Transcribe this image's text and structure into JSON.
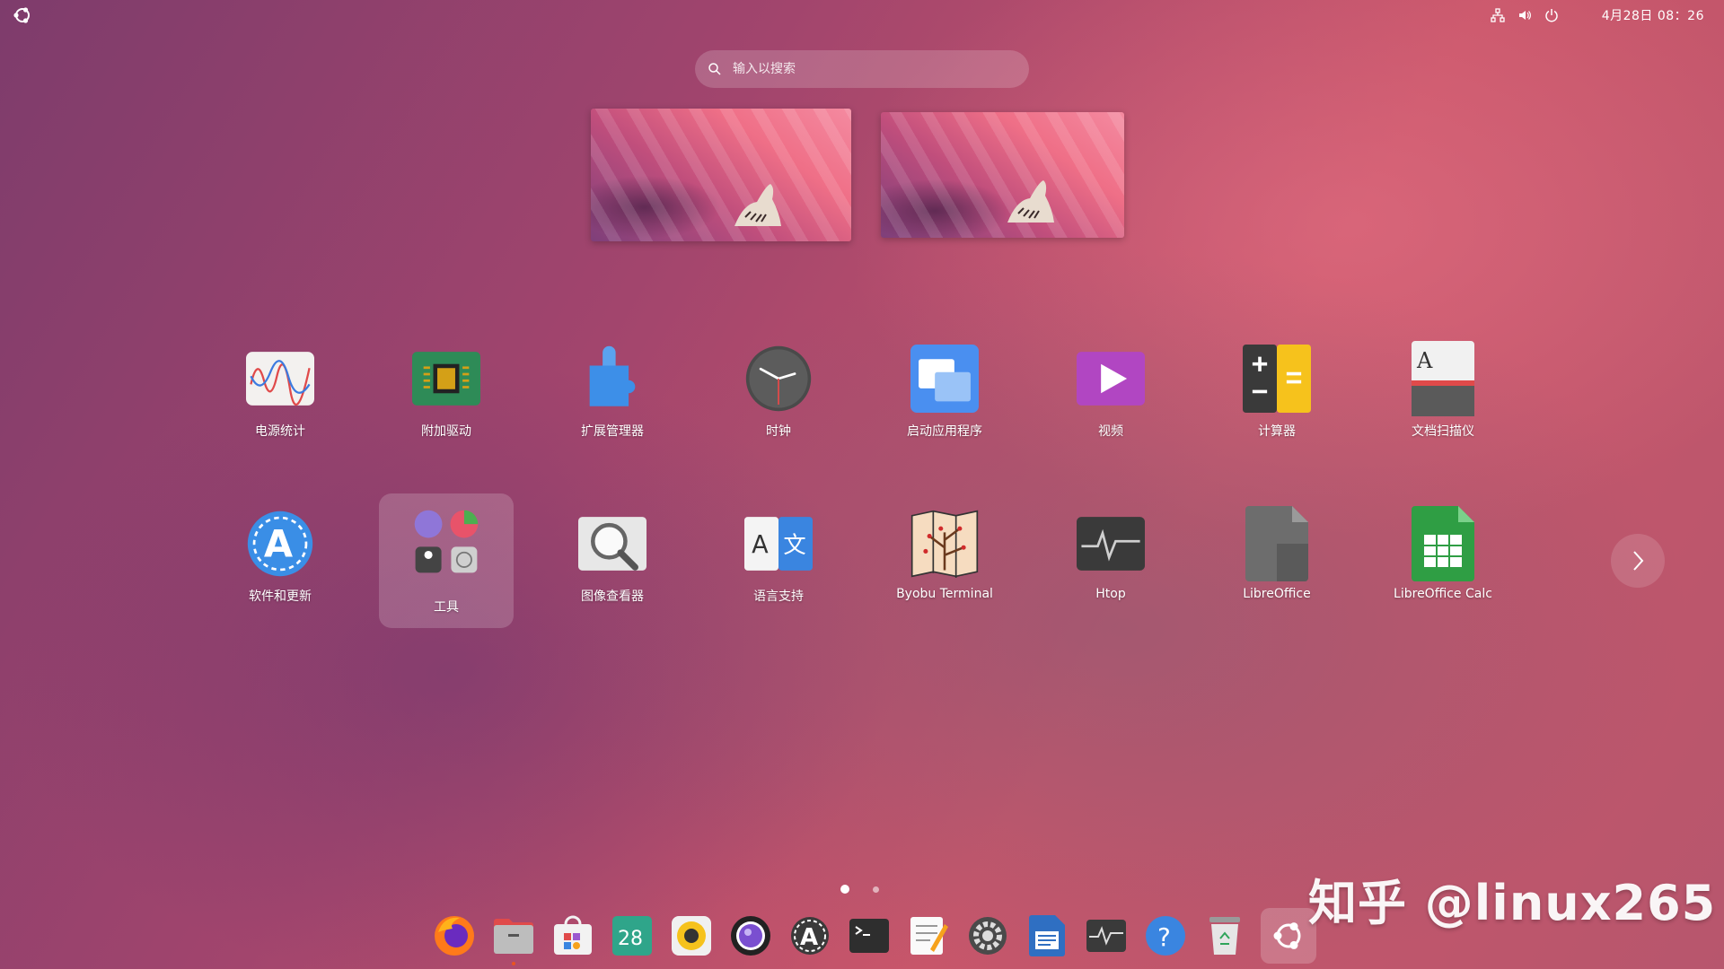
{
  "topbar": {
    "clock": "4月28日 08：26",
    "tray_icons": [
      "network-icon",
      "volume-icon",
      "power-icon"
    ]
  },
  "search": {
    "placeholder": "输入以搜索"
  },
  "apps_row1": [
    {
      "label": "电源统计",
      "icon": "power-statistics-icon"
    },
    {
      "label": "附加驱动",
      "icon": "additional-drivers-icon"
    },
    {
      "label": "扩展管理器",
      "icon": "extension-manager-icon"
    },
    {
      "label": "时钟",
      "icon": "clock-icon"
    },
    {
      "label": "启动应用程序",
      "icon": "startup-apps-icon"
    },
    {
      "label": "视频",
      "icon": "video-icon"
    },
    {
      "label": "计算器",
      "icon": "calculator-icon"
    },
    {
      "label": "文档扫描仪",
      "icon": "document-scanner-icon"
    }
  ],
  "apps_row2": [
    {
      "label": "软件和更新",
      "icon": "software-updates-icon"
    },
    {
      "label": "工具",
      "icon": "utilities-folder-icon"
    },
    {
      "label": "图像查看器",
      "icon": "image-viewer-icon"
    },
    {
      "label": "语言支持",
      "icon": "language-support-icon"
    },
    {
      "label": "Byobu Terminal",
      "icon": "byobu-terminal-icon"
    },
    {
      "label": "Htop",
      "icon": "htop-icon"
    },
    {
      "label": "LibreOffice",
      "icon": "libreoffice-icon"
    },
    {
      "label": "LibreOffice Calc",
      "icon": "libreoffice-calc-icon"
    }
  ],
  "pager": {
    "pages": 2,
    "current": 1
  },
  "dock": [
    {
      "name": "firefox",
      "running": false
    },
    {
      "name": "files",
      "running": true
    },
    {
      "name": "software-center",
      "running": false
    },
    {
      "name": "calendar",
      "running": false,
      "text": "28"
    },
    {
      "name": "rhythmbox",
      "running": false
    },
    {
      "name": "screenshot",
      "running": false
    },
    {
      "name": "software-updater",
      "running": false
    },
    {
      "name": "terminal",
      "running": false
    },
    {
      "name": "text-editor",
      "running": false
    },
    {
      "name": "settings",
      "running": false
    },
    {
      "name": "libreoffice-writer",
      "running": false
    },
    {
      "name": "system-monitor",
      "running": false
    },
    {
      "name": "help",
      "running": false
    },
    {
      "name": "trash",
      "running": false
    },
    {
      "name": "show-apps",
      "running": false,
      "active": true
    }
  ],
  "watermark": "知乎 @linux265",
  "colors": {
    "accent": "#e95420"
  }
}
